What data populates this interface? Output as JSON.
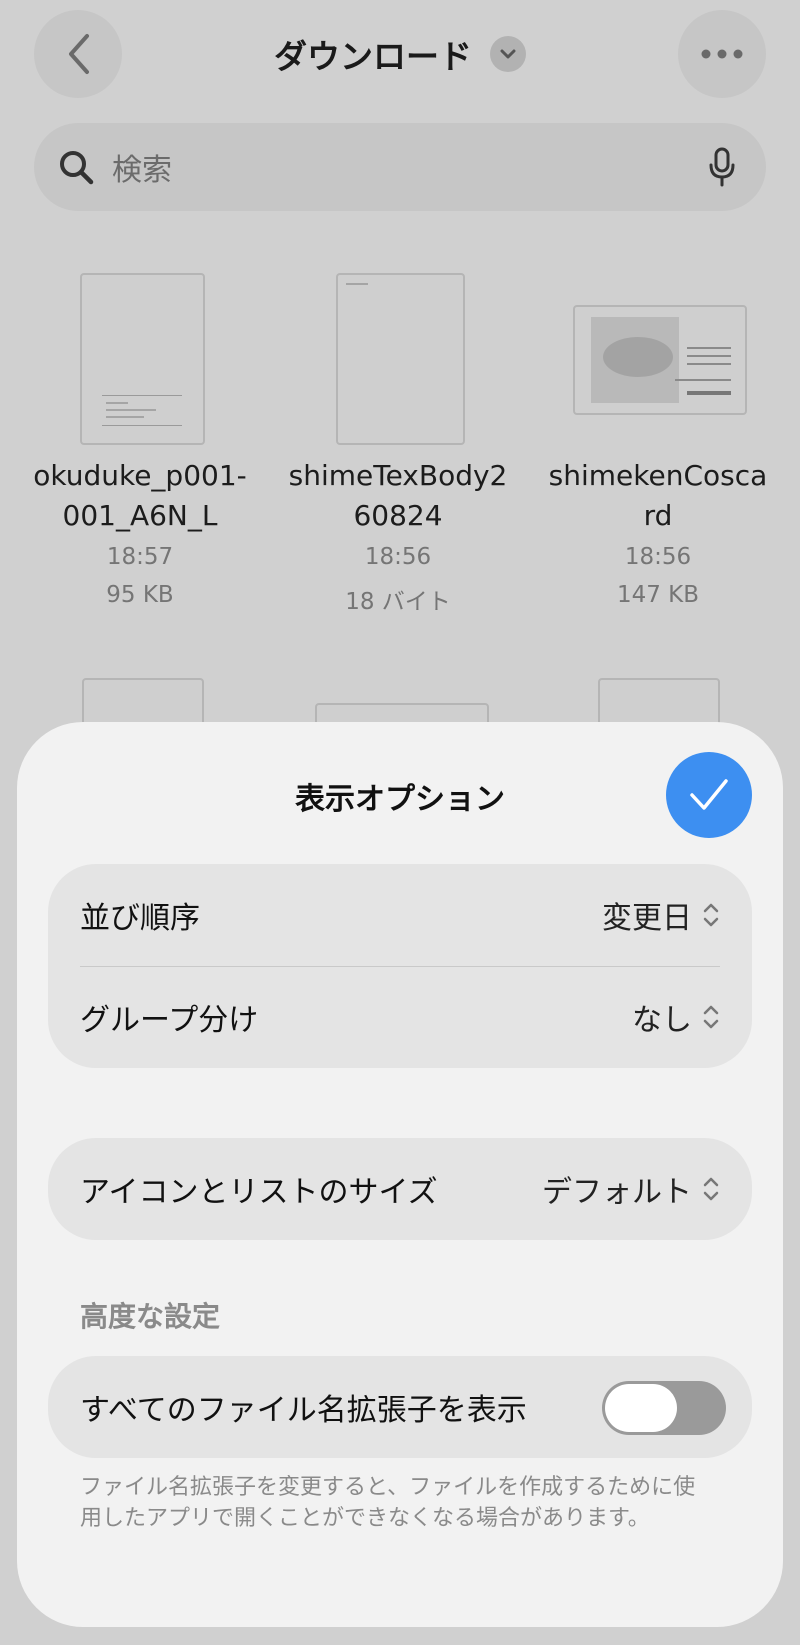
{
  "header": {
    "title": "ダウンロード",
    "back_icon": "chevron-left-icon",
    "more_icon": "ellipsis-icon"
  },
  "search": {
    "placeholder": "検索",
    "icon": "search-icon",
    "mic_icon": "microphone-icon"
  },
  "files": [
    {
      "name_line1": "okuduke_p001-",
      "name_line2": "001_A6N_L",
      "time": "18:57",
      "size": "95 KB"
    },
    {
      "name_line1": "shimeTexBody2",
      "name_line2": "60824",
      "time": "18:56",
      "size": "18 バイト"
    },
    {
      "name_line1": "shimekenCosca",
      "name_line2": "rd",
      "time": "18:56",
      "size": "147 KB"
    }
  ],
  "sheet": {
    "title": "表示オプション",
    "done_icon": "checkmark-icon",
    "sort_label": "並び順序",
    "sort_value": "変更日",
    "group_label": "グループ分け",
    "group_value": "なし",
    "size_label": "アイコンとリストのサイズ",
    "size_value": "デフォルト",
    "advanced_heading": "高度な設定",
    "ext_label": "すべてのファイル名拡張子を表示",
    "ext_toggle_on": false,
    "footnote": "ファイル名拡張子を変更すると、ファイルを作成するために使用したアプリで開くことができなくなる場合があります。"
  },
  "colors": {
    "accent": "#3d8ff1",
    "toggle_off": "#9a9a9a"
  }
}
